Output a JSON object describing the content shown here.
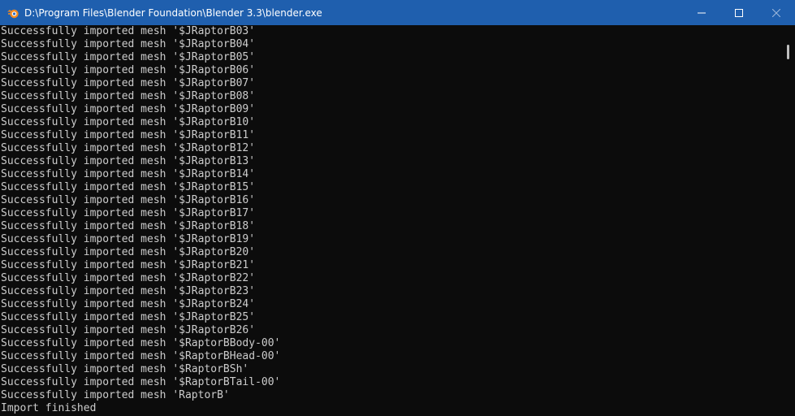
{
  "window": {
    "title": "D:\\Program Files\\Blender Foundation\\Blender 3.3\\blender.exe",
    "icon": "blender-icon",
    "title_bar_color": "#1f5fae"
  },
  "console": {
    "background": "#0c0c0c",
    "text_color": "#cccccc",
    "lines": [
      "Successfully imported mesh '$JRaptorB03'",
      "Successfully imported mesh '$JRaptorB04'",
      "Successfully imported mesh '$JRaptorB05'",
      "Successfully imported mesh '$JRaptorB06'",
      "Successfully imported mesh '$JRaptorB07'",
      "Successfully imported mesh '$JRaptorB08'",
      "Successfully imported mesh '$JRaptorB09'",
      "Successfully imported mesh '$JRaptorB10'",
      "Successfully imported mesh '$JRaptorB11'",
      "Successfully imported mesh '$JRaptorB12'",
      "Successfully imported mesh '$JRaptorB13'",
      "Successfully imported mesh '$JRaptorB14'",
      "Successfully imported mesh '$JRaptorB15'",
      "Successfully imported mesh '$JRaptorB16'",
      "Successfully imported mesh '$JRaptorB17'",
      "Successfully imported mesh '$JRaptorB18'",
      "Successfully imported mesh '$JRaptorB19'",
      "Successfully imported mesh '$JRaptorB20'",
      "Successfully imported mesh '$JRaptorB21'",
      "Successfully imported mesh '$JRaptorB22'",
      "Successfully imported mesh '$JRaptorB23'",
      "Successfully imported mesh '$JRaptorB24'",
      "Successfully imported mesh '$JRaptorB25'",
      "Successfully imported mesh '$JRaptorB26'",
      "Successfully imported mesh '$RaptorBBody-00'",
      "Successfully imported mesh '$RaptorBHead-00'",
      "Successfully imported mesh '$RaptorBSh'",
      "Successfully imported mesh '$RaptorBTail-00'",
      "Successfully imported mesh 'RaptorB'",
      "Import finished"
    ]
  },
  "controls": {
    "minimize_icon": "minimize-icon",
    "maximize_icon": "maximize-icon",
    "close_icon": "close-icon"
  }
}
